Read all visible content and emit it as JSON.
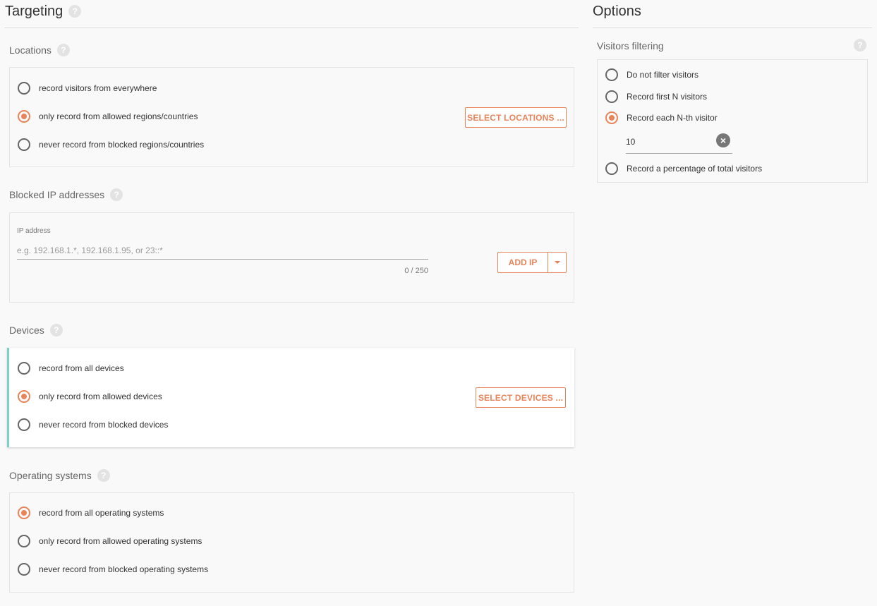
{
  "targeting": {
    "title": "Targeting",
    "locations": {
      "label": "Locations",
      "options": [
        "record visitors from everywhere",
        "only record from allowed regions/countries",
        "never record from blocked regions/countries"
      ],
      "selected_index": 1,
      "button_label": "SELECT LOCATIONS ..."
    },
    "blocked_ip": {
      "label": "Blocked IP addresses",
      "field_label": "IP address",
      "placeholder": "e.g. 192.168.1.*, 192.168.1.95, or 23::*",
      "counter": "0 / 250",
      "button_label": "ADD IP"
    },
    "devices": {
      "label": "Devices",
      "options": [
        "record from all devices",
        "only record from allowed devices",
        "never record from blocked devices"
      ],
      "selected_index": 1,
      "button_label": "SELECT DEVICES ..."
    },
    "operating_systems": {
      "label": "Operating systems",
      "options": [
        "record from all operating systems",
        "only record from allowed operating systems",
        "never record from blocked operating systems"
      ],
      "selected_index": 0
    }
  },
  "options": {
    "title": "Options",
    "visitors_filtering": {
      "label": "Visitors filtering",
      "options": [
        "Do not filter visitors",
        "Record first N visitors",
        "Record each N-th visitor",
        "Record a percentage of total visitors"
      ],
      "selected_index": 2,
      "n_value": "10"
    }
  },
  "help_glyph": "?",
  "clear_glyph": "×",
  "colors": {
    "accent": "#e8845a",
    "active_border": "#7ecfc9"
  }
}
